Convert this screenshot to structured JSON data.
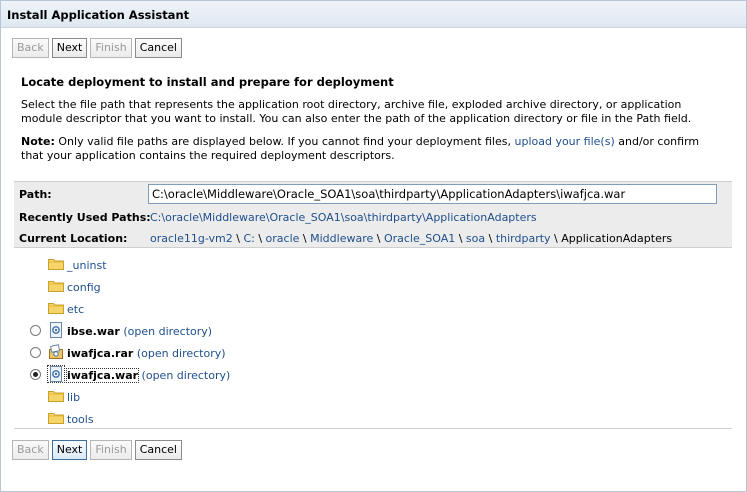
{
  "title": "Install Application Assistant",
  "buttons": {
    "back": "Back",
    "next": "Next",
    "finish": "Finish",
    "cancel": "Cancel"
  },
  "heading": "Locate deployment to install and prepare for deployment",
  "description": "Select the file path that represents the application root directory, archive file, exploded archive directory, or application module descriptor that you want to install. You can also enter the path of the application directory or file in the Path field.",
  "note": {
    "label": "Note:",
    "text_before": " Only valid file paths are displayed below. If you cannot find your deployment files, ",
    "link": "upload your file(s)",
    "text_after": " and/or confirm that your application contains the required deployment descriptors."
  },
  "path": {
    "label": "Path:",
    "value": "C:\\oracle\\Middleware\\Oracle_SOA1\\soa\\thirdparty\\ApplicationAdapters\\iwafjca.war"
  },
  "recent": {
    "label": "Recently Used Paths:",
    "value": "C:\\oracle\\Middleware\\Oracle_SOA1\\soa\\thirdparty\\ApplicationAdapters"
  },
  "location": {
    "label": "Current Location:",
    "crumbs": [
      "oracle11g-vm2",
      "C:",
      "oracle",
      "Middleware",
      "Oracle_SOA1",
      "soa",
      "thirdparty"
    ],
    "separator": " \\ ",
    "current": "ApplicationAdapters"
  },
  "entries": [
    {
      "name": "_uninst",
      "kind": "folder"
    },
    {
      "name": "config",
      "kind": "folder"
    },
    {
      "name": "etc",
      "kind": "folder"
    },
    {
      "name": "ibse.war",
      "kind": "war",
      "link": "(open directory)",
      "selected": false
    },
    {
      "name": "iwafjca.rar",
      "kind": "rar",
      "link": "(open directory)",
      "selected": false
    },
    {
      "name": "iwafjca.war",
      "kind": "war",
      "link": "(open directory)",
      "selected": true
    },
    {
      "name": "lib",
      "kind": "folder"
    },
    {
      "name": "tools",
      "kind": "folder"
    }
  ],
  "colors": {
    "link": "#1f4f8b",
    "panel": "#ececec",
    "folder": "#f2c94c"
  }
}
